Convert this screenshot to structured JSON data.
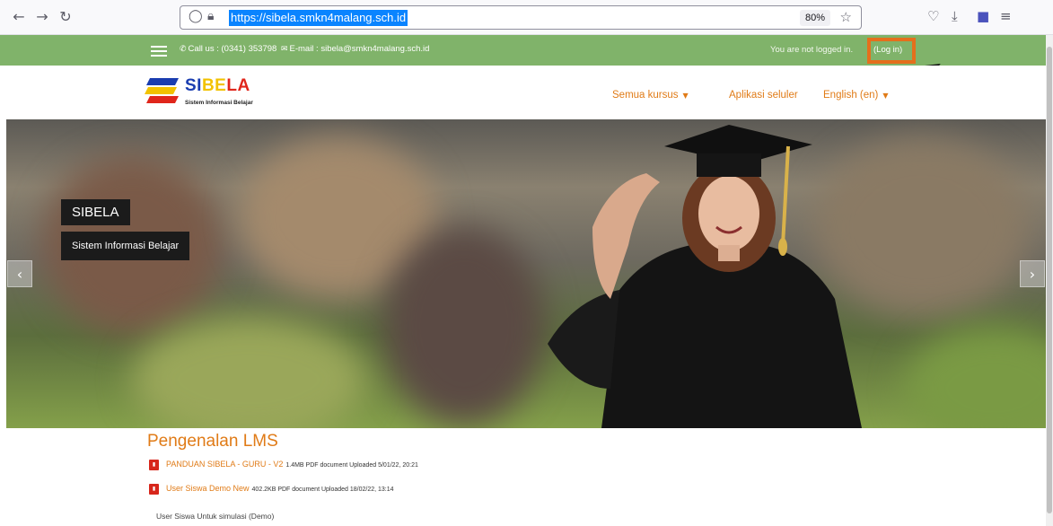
{
  "browser": {
    "url": "https://sibela.smkn4malang.sch.id",
    "zoom": "80%"
  },
  "topbar": {
    "contact": "Call us : (0341) 353798",
    "email": "E-mail : sibela@smkn4malang.sch.id",
    "login_status": "You are not logged in.",
    "login_link": "(Log in)"
  },
  "header": {
    "logo_title": {
      "si": "SI",
      "be": "BE",
      "la": "LA"
    },
    "logo_subtitle": "Sistem Informasi Belajar",
    "menu": [
      {
        "label": "Semua kursus",
        "dropdown": true
      },
      {
        "label": "Aplikasi seluler",
        "dropdown": false
      },
      {
        "label": "English (en)",
        "dropdown": true
      }
    ]
  },
  "slider": {
    "title": "SIBELA",
    "caption": "Sistem Informasi Belajar"
  },
  "main": {
    "section_title": "Pengenalan LMS",
    "files": [
      {
        "name": "PANDUAN SIBELA - GURU - V2",
        "meta": "1.4MB PDF document Uploaded 5/01/22, 20:21"
      },
      {
        "name": "User Siswa Demo New",
        "meta": "402.2KB PDF document Uploaded 18/02/22, 13:14"
      }
    ],
    "description": "User Siswa Untuk simulasi (Demo)"
  },
  "colors": {
    "topbar": "#80b36a",
    "accent": "#e07b17",
    "highlight_box": "#e56f1c",
    "annotation_arrow": "#1f9a35"
  }
}
